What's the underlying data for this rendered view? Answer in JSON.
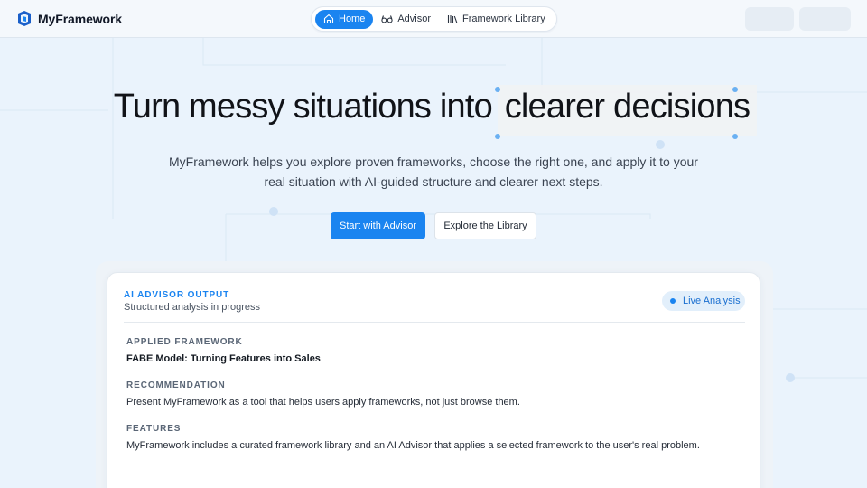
{
  "header": {
    "brand": "MyFramework",
    "nav": [
      {
        "label": "Home",
        "icon": "home-icon",
        "active": true
      },
      {
        "label": "Advisor",
        "icon": "glasses-icon",
        "active": false
      },
      {
        "label": "Framework Library",
        "icon": "library-icon",
        "active": false
      }
    ]
  },
  "hero": {
    "title_main": "Turn messy situations into",
    "title_highlight": "clearer decisions",
    "subtitle_line1": "MyFramework helps you explore proven frameworks, choose the right one, and apply it to your",
    "subtitle_line2": "real situation with AI-guided structure and clearer next steps.",
    "primary_cta": "Start with Advisor",
    "secondary_cta": "Explore the Library"
  },
  "card": {
    "eyebrow": "AI ADVISOR OUTPUT",
    "status": "Structured analysis in progress",
    "badge": "Live Analysis",
    "sections": [
      {
        "label": "APPLIED FRAMEWORK",
        "value": "FABE Model: Turning Features into Sales"
      },
      {
        "label": "RECOMMENDATION",
        "value": "Present MyFramework as a tool that helps users apply frameworks, not just browse them."
      },
      {
        "label": "FEATURES",
        "value": "MyFramework includes a curated framework library and an AI Advisor that applies a selected framework to the user's real problem."
      }
    ]
  },
  "colors": {
    "accent": "#1a84f0",
    "background": "#eaf3fc",
    "text": "#111318"
  }
}
